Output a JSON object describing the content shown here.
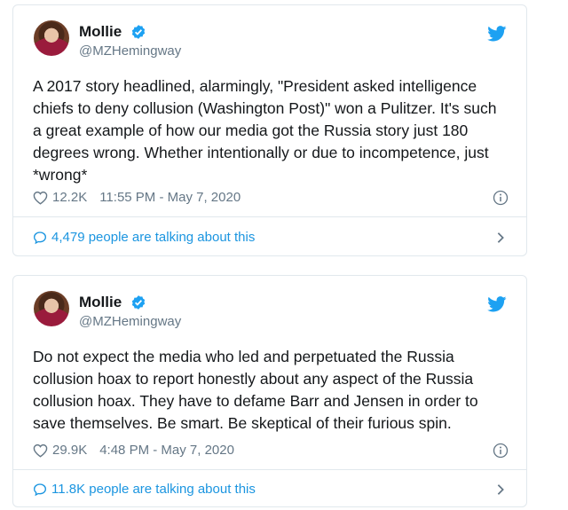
{
  "tweets": [
    {
      "name": "Mollie",
      "handle": "@MZHemingway",
      "text": "A 2017 story headlined, alarmingly, \"President asked intelligence chiefs to deny collusion (Washington Post)\" won a Pulitzer. It's such a great example of how our media got the Russia story just 180 degrees wrong. Whether intentionally or due to incompetence, just *wrong*",
      "likes": "12.2K",
      "timestamp": "11:55 PM - May 7, 2020",
      "talking": "4,479 people are talking about this"
    },
    {
      "name": "Mollie",
      "handle": "@MZHemingway",
      "text": "Do not expect the media who led and perpetuated the Russia collusion hoax to report honestly about any aspect of the Russia collusion hoax. They have to defame Barr and Jensen in order to save themselves. Be smart. Be skeptical of their furious spin.",
      "likes": "29.9K",
      "timestamp": "4:48 PM - May 7, 2020",
      "talking": "11.8K people are talking about this"
    }
  ],
  "colors": {
    "twitter_blue": "#1da1f2",
    "link_blue": "#1b95e0",
    "muted": "#657786"
  },
  "icons": [
    "verified-badge-icon",
    "twitter-bird-icon",
    "heart-icon",
    "info-icon",
    "speech-bubble-icon",
    "chevron-right-icon"
  ]
}
